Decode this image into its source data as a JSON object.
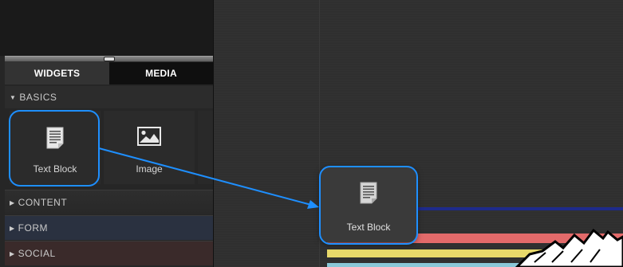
{
  "tabs": {
    "widgets": "WIDGETS",
    "media": "MEDIA"
  },
  "sections": {
    "basics": "BASICS",
    "content": "CONTENT",
    "form": "FORM",
    "social": "SOCIAL"
  },
  "widgets": {
    "text_block": "Text Block",
    "image": "Image"
  },
  "drag_preview": {
    "label": "Text Block"
  },
  "colors": {
    "highlight": "#1e8fff",
    "form_section": "#2a3140",
    "social_section": "#3a2a2a"
  }
}
